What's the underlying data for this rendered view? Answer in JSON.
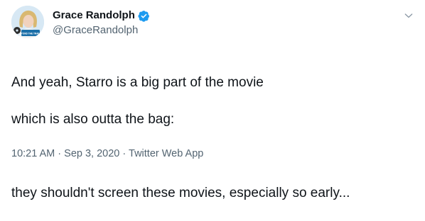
{
  "author": {
    "display_name": "Grace Randolph",
    "handle": "@GraceRandolph",
    "verified": true,
    "avatar_badge_text": "BEYOND THE TRAILER"
  },
  "tweet": {
    "lines": [
      "And yeah, Starro is a big part of the movie",
      "which is also outta the bag:",
      "",
      "they shouldn't screen these movies, especially so early..."
    ]
  },
  "meta": {
    "time": "10:21 AM",
    "separator": "·",
    "date": "Sep 3, 2020",
    "source": "Twitter Web App"
  },
  "colors": {
    "text": "#0f1419",
    "secondary": "#536471",
    "verified_badge": "#1d9bf0"
  },
  "icons": {
    "verified": "verified-badge-icon",
    "menu": "chevron-down-icon"
  }
}
